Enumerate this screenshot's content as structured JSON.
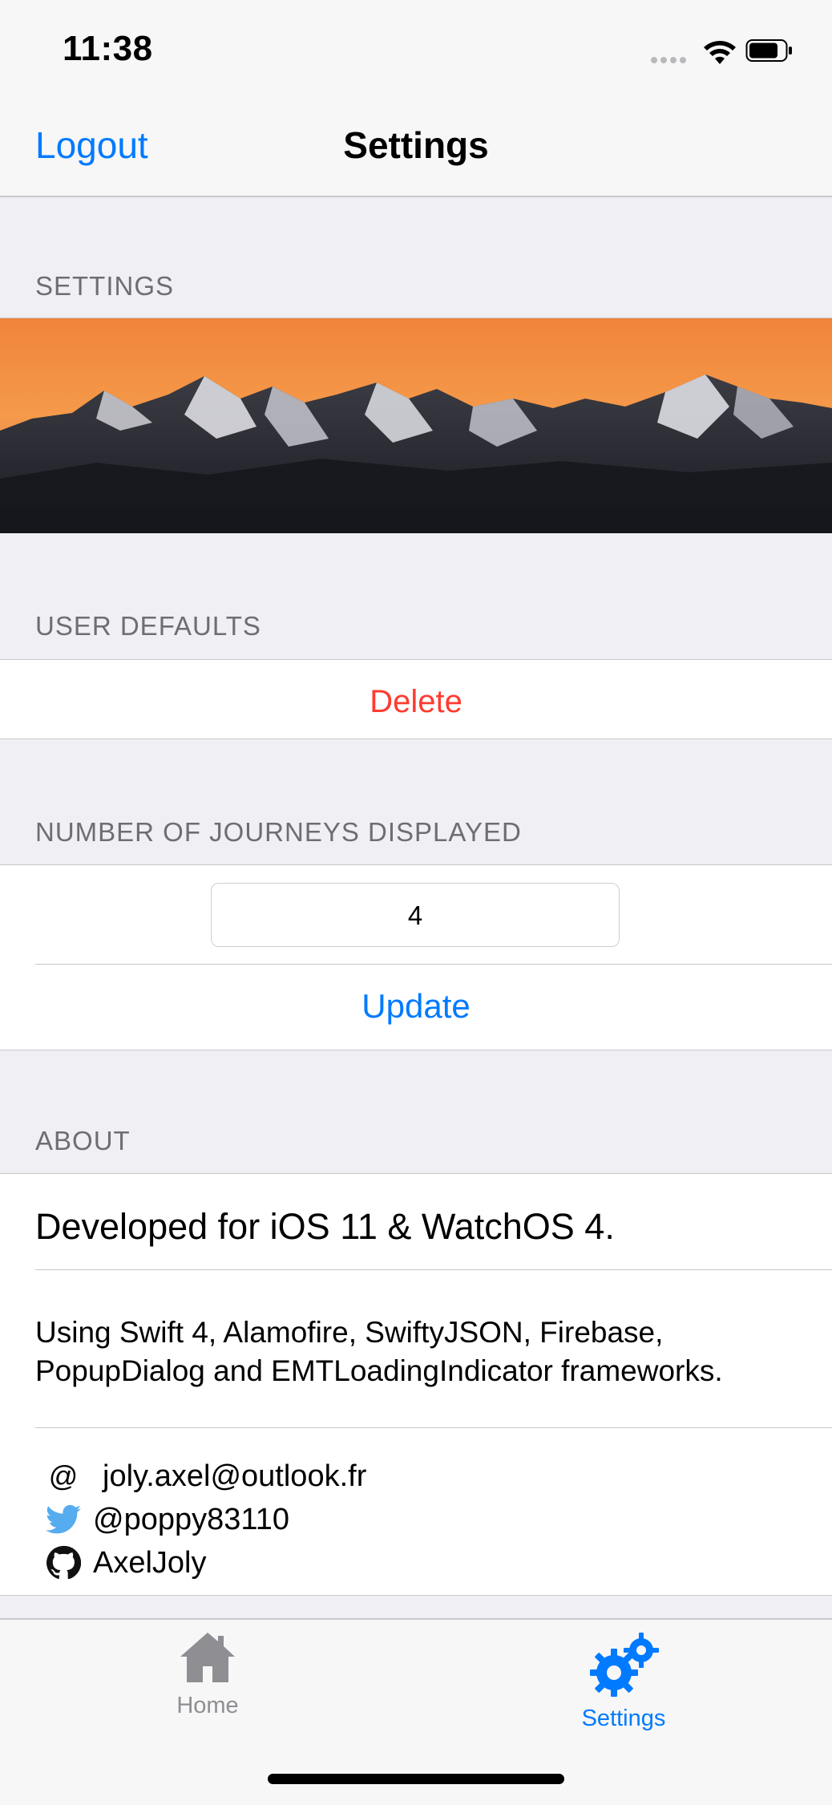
{
  "status": {
    "time": "11:38"
  },
  "nav": {
    "left_button": "Logout",
    "title": "Settings"
  },
  "sections": {
    "settings_header": "SETTINGS",
    "user_defaults_header": "USER DEFAULTS",
    "journeys_header": "NUMBER OF JOURNEYS DISPLAYED",
    "about_header": "ABOUT"
  },
  "user_defaults": {
    "delete_label": "Delete"
  },
  "journeys": {
    "value": "4",
    "update_label": "Update"
  },
  "about": {
    "line1": "Developed for iOS 11 & WatchOS 4.",
    "line2": "Using Swift 4, Alamofire, SwiftyJSON, Firebase, PopupDialog and EMTLoadingIndicator frameworks.",
    "email_symbol": "@",
    "email": "joly.axel@outlook.fr",
    "twitter": "@poppy83110",
    "github": "AxelJoly"
  },
  "tabs": [
    {
      "label": "Home",
      "icon": "home-icon",
      "active": false
    },
    {
      "label": "Settings",
      "icon": "settings-gears-icon",
      "active": true
    }
  ],
  "colors": {
    "accent": "#007aff",
    "destructive": "#ff3b30",
    "inactive_tab": "#8e8e93",
    "twitter": "#55acee"
  }
}
